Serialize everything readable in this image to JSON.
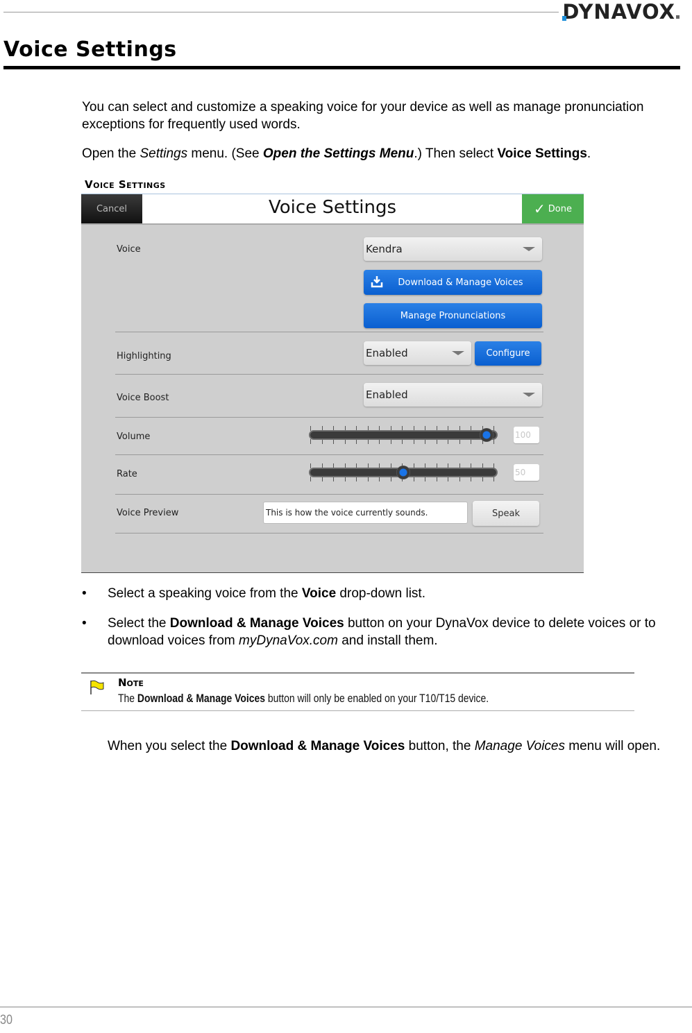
{
  "header": {
    "brand": "DYNAVOX"
  },
  "page": {
    "title": "Voice Settings",
    "intro": "You can select and customize a speaking voice for your device as well as manage pronunciation exceptions for frequently used words.",
    "instruction": {
      "part1": "Open the ",
      "settings_word": "Settings",
      "part2": " menu. (See ",
      "link": "Open the Settings Menu",
      "part3": ".) Then select ",
      "target": "Voice Settings",
      "part4": "."
    },
    "figure_caption": "Voice Settings",
    "page_number": "30"
  },
  "screen": {
    "cancel_label": "Cancel",
    "title": "Voice Settings",
    "done_label": "Done",
    "rows": {
      "voice": {
        "label": "Voice",
        "value": "Kendra"
      },
      "download_button": "Download & Manage Voices",
      "pronunciations_button": "Manage Pronunciations",
      "highlighting": {
        "label": "Highlighting",
        "value": "Enabled",
        "configure": "Configure"
      },
      "voice_boost": {
        "label": "Voice Boost",
        "value": "Enabled"
      },
      "volume": {
        "label": "Volume",
        "value": "100",
        "fraction": 1.0
      },
      "rate": {
        "label": "Rate",
        "value": "50",
        "fraction": 0.5
      },
      "preview": {
        "label": "Voice Preview",
        "text": "This is how the voice currently sounds.",
        "speak": "Speak"
      }
    }
  },
  "bullets": [
    {
      "pre": "Select a speaking voice from the ",
      "bold": "Voice",
      "post": " drop-down list."
    },
    {
      "pre": "Select the ",
      "bold": "Download & Manage Voices",
      "post": " button on your DynaVox device to delete voices or to download voices from ",
      "italic": "myDynaVox.com",
      "post2": " and install them."
    }
  ],
  "note": {
    "title": "Note",
    "pre": "The ",
    "bold": "Download & Manage Voices",
    "post": " button will only be enabled on your T10/T15 device."
  },
  "closing": {
    "pre": "When you select the ",
    "bold": "Download & Manage Voices",
    "mid": " button, the ",
    "italic": "Manage Voices",
    "post": " menu will open."
  },
  "colors": {
    "done_green": "#4caf50",
    "button_blue": "#0a5fd0",
    "slider_knob": "#1a74e8"
  }
}
